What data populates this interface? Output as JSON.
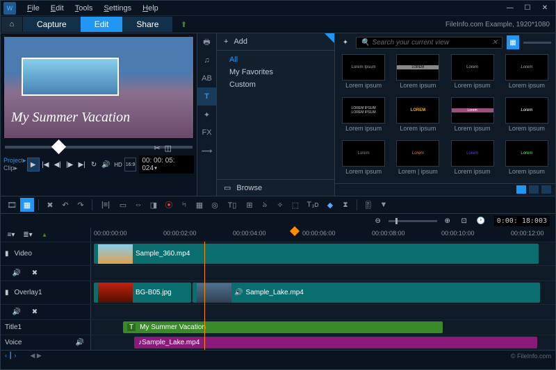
{
  "menu": {
    "file": "File",
    "edit": "Edit",
    "tools": "Tools",
    "settings": "Settings",
    "help": "Help"
  },
  "tabs": {
    "capture": "Capture",
    "edit": "Edit",
    "share": "Share"
  },
  "project_info": "FileInfo.com Example, 1920*1080",
  "preview": {
    "title_text": "My Summer Vacation",
    "project": "Project",
    "clip": "Clip",
    "hd": "HD",
    "ratio": "16:9",
    "tc": "00: 00: 05: 024"
  },
  "categories": {
    "add": "Add",
    "all": "All",
    "fav": "My Favorites",
    "custom": "Custom",
    "browse": "Browse"
  },
  "search": {
    "placeholder": "Search your current view"
  },
  "thumbs": [
    {
      "label": "Lorem ipsum"
    },
    {
      "label": "Lorem ipsum"
    },
    {
      "label": "Lorem ipsum"
    },
    {
      "label": "Lorem ipsum"
    },
    {
      "label": "Lorem ipsum"
    },
    {
      "label": "Lorem ipsum"
    },
    {
      "label": "Lorem ipsum"
    },
    {
      "label": "Lorem ipsum"
    },
    {
      "label": "Lorem ipsum"
    },
    {
      "label": "Lorem | ipsum"
    },
    {
      "label": "Lorem ipsum"
    },
    {
      "label": "Lorem ipsum"
    }
  ],
  "tool_sidebar": {
    "t": "T",
    "fx": "FX"
  },
  "zoom": {
    "tc": "0:00: 18:003"
  },
  "ruler": [
    "00:00:00:00",
    "00:00:02:00",
    "00:00:04:00",
    "00:00:06:00",
    "00:00:08:00",
    "00:00:10:00",
    "00:00:12:00"
  ],
  "tracks": {
    "video": {
      "name": "Video",
      "clip": "Sample_360.mp4"
    },
    "overlay": {
      "name": "Overlay1",
      "clip1": "BG-B05.jpg",
      "clip2": "Sample_Lake.mp4"
    },
    "title": {
      "name": "Title1",
      "clip": "My Summer Vacation",
      "marker": "T"
    },
    "voice": {
      "name": "Voice",
      "clip": "Sample_Lake.mp4"
    }
  },
  "footer": "© FileInfo.com"
}
